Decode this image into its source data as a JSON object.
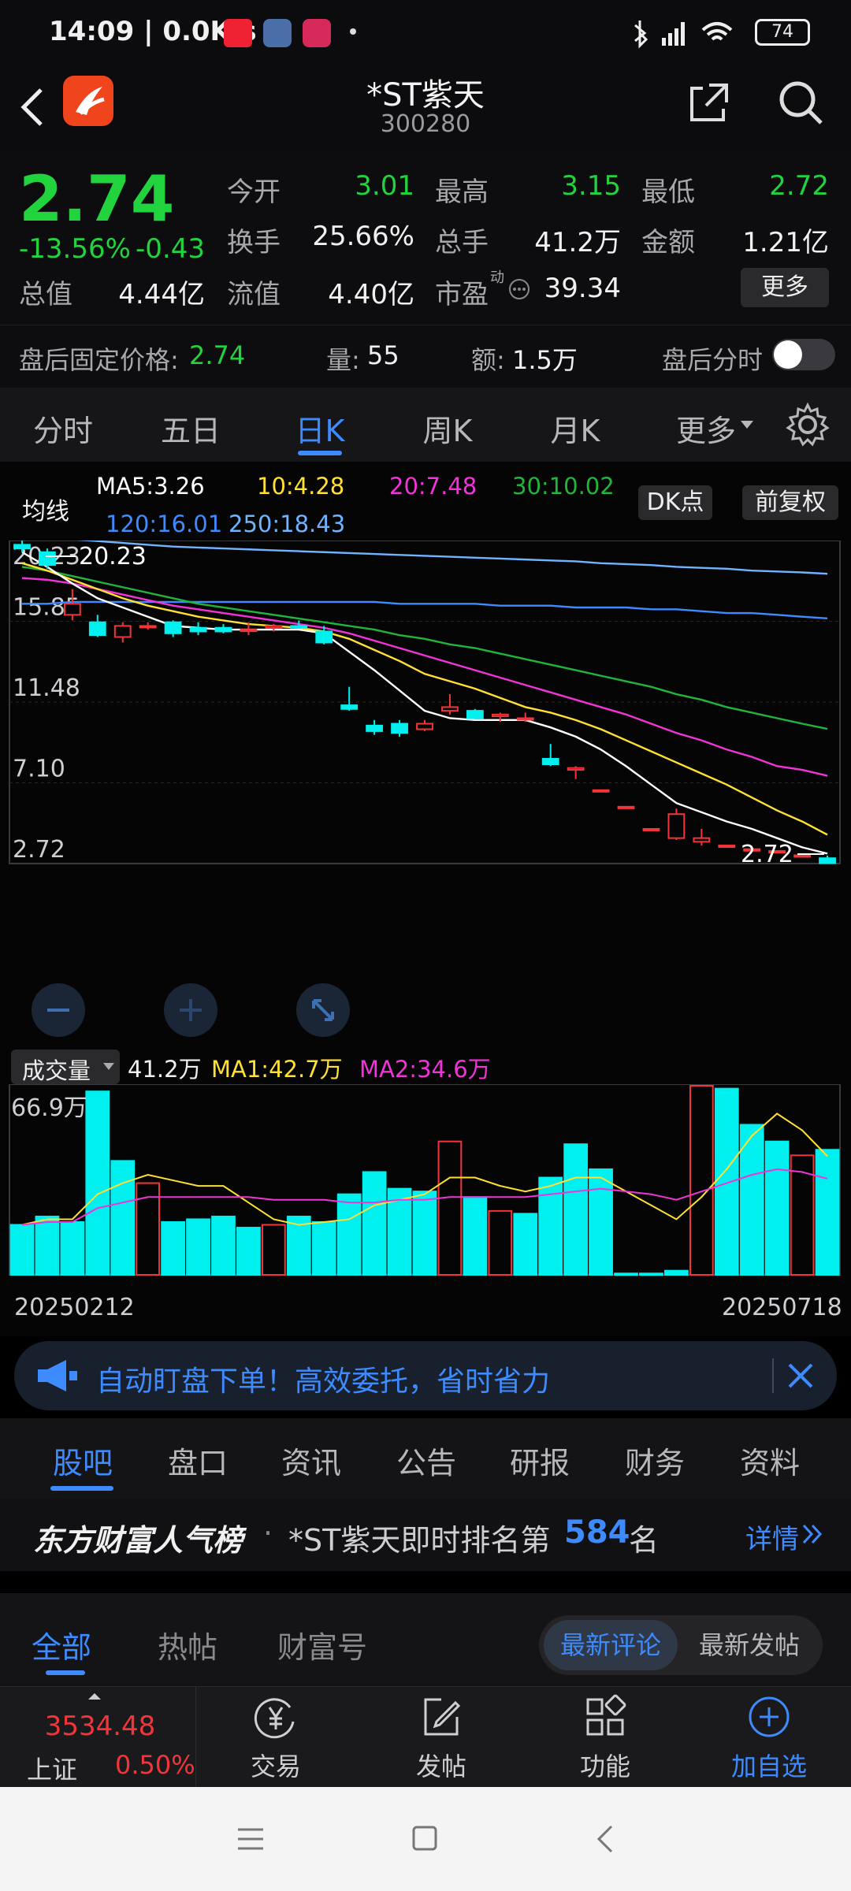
{
  "status": {
    "time_speed": "14:09 | 0.0K/s",
    "battery": "74"
  },
  "header": {
    "title": "*ST紫天",
    "code": "300280"
  },
  "quote": {
    "price": "2.74",
    "change_pct": "-13.56%",
    "change": "-0.43",
    "open_label": "今开",
    "open": "3.01",
    "high_label": "最高",
    "high": "3.15",
    "low_label": "最低",
    "low": "2.72",
    "turnover_label": "换手",
    "turnover": "25.66%",
    "volume_label": "总手",
    "volume": "41.2万",
    "amount_label": "金额",
    "amount": "1.21亿",
    "mktcap_label": "总值",
    "mktcap": "4.44亿",
    "float_label": "流值",
    "float": "4.40亿",
    "pe_label": "市盈",
    "pe_sup": "动",
    "pe": "39.34",
    "more": "更多"
  },
  "afterhours": {
    "price_label": "盘后固定价格:",
    "price": "2.74",
    "vol_label": "量:",
    "vol": "55",
    "amt_label": "额:",
    "amt": "1.5万",
    "intraday_label": "盘后分时"
  },
  "chart_tabs": [
    "分时",
    "五日",
    "日K",
    "周K",
    "月K",
    "更多"
  ],
  "ma": {
    "label": "均线",
    "ma5": "MA5:3.26",
    "ma10": "10:4.28",
    "ma20": "20:7.48",
    "ma30": "30:10.02",
    "ma120": "120:16.01",
    "ma250": "250:18.43",
    "dk": "DK点",
    "fq": "前复权"
  },
  "price_axis": {
    "p1": "20.23",
    "p2": "15.85",
    "p3": "11.48",
    "p4": "7.10",
    "p5": "2.72",
    "high_mark": "20.23",
    "low_mark": "2.72"
  },
  "volume_bar": {
    "selector": "成交量",
    "vol": "41.2万",
    "ma1": "MA1:42.7万",
    "ma2": "MA2:34.6万",
    "axis_max": "66.9万"
  },
  "dates": {
    "start": "20250212",
    "end": "20250718"
  },
  "banner": {
    "text": "自动盯盘下单！高效委托，省时省力"
  },
  "sub_tabs": [
    "股吧",
    "盘口",
    "资讯",
    "公告",
    "研报",
    "财务",
    "资料"
  ],
  "rank": {
    "brand": "东方财富人气榜",
    "text": "*ST紫天即时排名第",
    "number": "584",
    "unit": "名",
    "detail": "详情"
  },
  "filter": {
    "tabs": [
      "全部",
      "热帖",
      "财富号"
    ],
    "sort_a": "最新评论",
    "sort_b": "最新发帖"
  },
  "bottom": {
    "index_value": "3534.48",
    "index_name": "上证",
    "index_pct": "0.50%",
    "trade": "交易",
    "post": "发帖",
    "func": "功能",
    "add": "加自选"
  },
  "colors": {
    "up": "#f3353a",
    "down": "#21d33c",
    "accent": "#3e8bff",
    "candle_down": "#00f0f0",
    "ma5": "#ffffff",
    "ma10": "#ffe033",
    "ma20": "#f233d8",
    "ma30": "#21b53c",
    "ma120": "#3e8bff",
    "ma250": "#6fb4ff"
  },
  "chart_data": {
    "type": "candlestick",
    "y_range": [
      2.72,
      20.23
    ],
    "candles": [
      {
        "o": 20.0,
        "h": 20.23,
        "l": 19.6,
        "c": 19.8
      },
      {
        "o": 19.6,
        "h": 19.8,
        "l": 18.7,
        "c": 18.9
      },
      {
        "o": 16.2,
        "h": 17.6,
        "l": 15.9,
        "c": 16.8
      },
      {
        "o": 15.8,
        "h": 16.2,
        "l": 15.0,
        "c": 15.1
      },
      {
        "o": 15.0,
        "h": 15.8,
        "l": 14.7,
        "c": 15.6
      },
      {
        "o": 15.6,
        "h": 15.8,
        "l": 15.4,
        "c": 15.6
      },
      {
        "o": 15.8,
        "h": 15.9,
        "l": 15.0,
        "c": 15.2
      },
      {
        "o": 15.5,
        "h": 15.8,
        "l": 15.1,
        "c": 15.3
      },
      {
        "o": 15.5,
        "h": 15.7,
        "l": 15.2,
        "c": 15.3
      },
      {
        "o": 15.4,
        "h": 15.8,
        "l": 15.1,
        "c": 15.4
      },
      {
        "o": 15.5,
        "h": 15.7,
        "l": 15.3,
        "c": 15.6
      },
      {
        "o": 15.6,
        "h": 15.9,
        "l": 15.5,
        "c": 15.5
      },
      {
        "o": 15.3,
        "h": 15.6,
        "l": 14.6,
        "c": 14.7
      },
      {
        "o": 11.3,
        "h": 12.3,
        "l": 11.0,
        "c": 11.1
      },
      {
        "o": 10.2,
        "h": 10.5,
        "l": 9.7,
        "c": 9.9
      },
      {
        "o": 10.3,
        "h": 10.5,
        "l": 9.6,
        "c": 9.8
      },
      {
        "o": 10.0,
        "h": 10.5,
        "l": 9.9,
        "c": 10.3
      },
      {
        "o": 11.0,
        "h": 11.9,
        "l": 10.8,
        "c": 11.2
      },
      {
        "o": 11.0,
        "h": 11.1,
        "l": 10.6,
        "c": 10.6
      },
      {
        "o": 10.7,
        "h": 10.9,
        "l": 10.4,
        "c": 10.8
      },
      {
        "o": 10.6,
        "h": 10.9,
        "l": 10.4,
        "c": 10.6
      },
      {
        "o": 8.4,
        "h": 9.2,
        "l": 8.0,
        "c": 8.1
      },
      {
        "o": 7.8,
        "h": 8.0,
        "l": 7.3,
        "c": 7.9
      },
      {
        "o": 6.7,
        "h": 6.7,
        "l": 6.7,
        "c": 6.7
      },
      {
        "o": 5.8,
        "h": 5.8,
        "l": 5.8,
        "c": 5.8
      },
      {
        "o": 4.6,
        "h": 4.6,
        "l": 4.6,
        "c": 4.6
      },
      {
        "o": 4.1,
        "h": 5.7,
        "l": 4.0,
        "c": 5.4
      },
      {
        "o": 3.9,
        "h": 4.6,
        "l": 3.7,
        "c": 4.1
      },
      {
        "o": 3.7,
        "h": 3.7,
        "l": 3.7,
        "c": 3.7
      },
      {
        "o": 3.5,
        "h": 3.5,
        "l": 3.5,
        "c": 3.5
      },
      {
        "o": 3.4,
        "h": 3.4,
        "l": 3.4,
        "c": 3.4
      },
      {
        "o": 3.17,
        "h": 3.17,
        "l": 3.17,
        "c": 3.17
      },
      {
        "o": 3.01,
        "h": 3.15,
        "l": 2.72,
        "c": 2.74
      }
    ],
    "ma5": [
      19.6,
      18.8,
      17.9,
      17.1,
      16.6,
      16.1,
      15.6,
      15.5,
      15.4,
      15.4,
      15.4,
      15.4,
      15.2,
      14.2,
      13.2,
      12.1,
      11.0,
      10.6,
      10.5,
      10.5,
      10.5,
      10.1,
      9.6,
      8.9,
      8.0,
      7.0,
      6.0,
      5.5,
      5.0,
      4.6,
      4.1,
      3.6,
      3.26
    ],
    "ma10": [
      19.0,
      18.6,
      18.1,
      17.6,
      17.1,
      16.7,
      16.4,
      16.1,
      15.9,
      15.7,
      15.6,
      15.5,
      15.3,
      14.9,
      14.3,
      13.7,
      13.0,
      12.6,
      12.2,
      11.7,
      11.2,
      10.9,
      10.5,
      10.0,
      9.4,
      8.8,
      8.2,
      7.6,
      7.0,
      6.3,
      5.6,
      5.0,
      4.28
    ],
    "ma20": [
      18.2,
      18.1,
      17.9,
      17.6,
      17.3,
      17.0,
      16.7,
      16.5,
      16.3,
      16.1,
      15.9,
      15.7,
      15.5,
      15.2,
      14.8,
      14.4,
      14.0,
      13.6,
      13.2,
      12.8,
      12.4,
      12.0,
      11.6,
      11.2,
      10.8,
      10.3,
      9.8,
      9.4,
      8.9,
      8.5,
      8.0,
      7.8,
      7.48
    ],
    "ma30": [
      18.8,
      18.6,
      18.3,
      18.0,
      17.7,
      17.4,
      17.1,
      16.8,
      16.6,
      16.4,
      16.2,
      16.0,
      15.8,
      15.6,
      15.4,
      15.1,
      14.9,
      14.6,
      14.4,
      14.1,
      13.8,
      13.5,
      13.2,
      12.9,
      12.6,
      12.3,
      11.9,
      11.6,
      11.2,
      10.9,
      10.6,
      10.3,
      10.02
    ],
    "ma120": [
      16.8,
      16.8,
      16.9,
      16.9,
      16.9,
      16.9,
      16.9,
      16.9,
      16.9,
      16.9,
      16.9,
      16.9,
      16.9,
      16.9,
      16.9,
      16.8,
      16.8,
      16.8,
      16.8,
      16.7,
      16.7,
      16.7,
      16.6,
      16.6,
      16.6,
      16.5,
      16.5,
      16.4,
      16.3,
      16.3,
      16.2,
      16.1,
      16.01
    ],
    "ma250": [
      20.5,
      20.4,
      20.3,
      20.2,
      20.1,
      20.0,
      19.9,
      19.85,
      19.8,
      19.75,
      19.7,
      19.65,
      19.6,
      19.55,
      19.5,
      19.45,
      19.4,
      19.35,
      19.3,
      19.25,
      19.2,
      19.15,
      19.1,
      19.0,
      18.95,
      18.9,
      18.8,
      18.75,
      18.7,
      18.6,
      18.55,
      18.5,
      18.43
    ],
    "volume": {
      "ymax": 66.9,
      "values": [
        18,
        21,
        19,
        66,
        41,
        33,
        19,
        20,
        21,
        17,
        18,
        21,
        19,
        29,
        37,
        31,
        30,
        48,
        28,
        23,
        22,
        35,
        47,
        38,
        0.5,
        0.5,
        1.5,
        70,
        67,
        54,
        48,
        43,
        45
      ],
      "up": [
        0,
        0,
        0,
        0,
        0,
        1,
        0,
        0,
        0,
        0,
        1,
        0,
        0,
        0,
        0,
        0,
        0,
        1,
        0,
        1,
        0,
        0,
        0,
        0,
        0,
        0,
        0,
        1,
        0,
        0,
        0,
        1,
        0
      ],
      "ma1": [
        18,
        20,
        20,
        29,
        33,
        36,
        34,
        32,
        32,
        26,
        20,
        18,
        19,
        20,
        25,
        27,
        29,
        35,
        35,
        32,
        30,
        32,
        35,
        35,
        30,
        25,
        20,
        28,
        38,
        50,
        58,
        52,
        42.7
      ],
      "ma2": [
        18,
        19,
        19,
        24,
        26,
        28,
        28,
        28,
        28,
        28,
        27,
        27,
        27,
        26,
        26,
        27,
        27,
        28,
        28,
        28,
        28,
        29,
        30,
        31,
        30,
        29,
        27,
        30,
        33,
        36,
        38,
        37,
        34.6
      ]
    }
  }
}
